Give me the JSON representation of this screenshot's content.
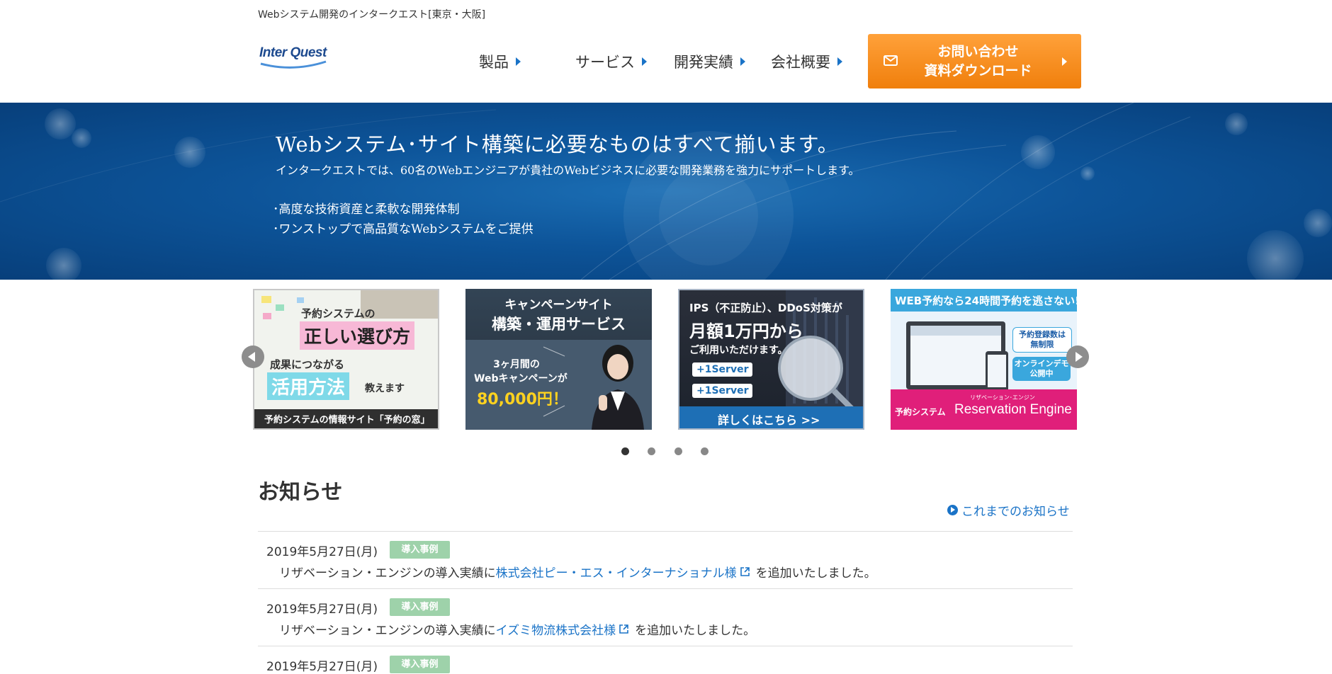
{
  "header": {
    "tagline": "Webシステム開発のインタークエスト[東京・大阪]",
    "logo_text": "Inter Quest",
    "nav": [
      {
        "label": "製品"
      },
      {
        "label": "サービス"
      },
      {
        "label": "開発実績"
      },
      {
        "label": "会社概要"
      }
    ],
    "contact_button": {
      "line1": "お問い合わせ",
      "line2": "資料ダウンロード"
    }
  },
  "hero": {
    "title": "Webシステム･サイト構築に必要なものはすべて揃います。",
    "description": "インタークエストでは、60名のWebエンジニアが貴社のWebビジネスに必要な開発業務を強力にサポートします。",
    "bullets": [
      "･高度な技術資産と柔軟な開発体制",
      "･ワンストップで高品質なWebシステムをご提供"
    ]
  },
  "carousel": {
    "slides": [
      {
        "line1": "予約システムの",
        "line2": "正しい選び方",
        "line3": "成果につながる",
        "line4": "活用方法",
        "line5": "教えます",
        "footer": "予約システムの情報サイト「予約の窓」"
      },
      {
        "line1": "キャンペーンサイト",
        "line2": "構築・運用サービス",
        "line3": "3ヶ月間の",
        "line4": "Webキャンペーンが",
        "line5": "80,000円！"
      },
      {
        "line1": "IPS（不正防止）、DDoS対策が",
        "line2": "月額1万円から",
        "line3": "ご利用いただけます。",
        "badge1": "+1Server",
        "badge2": "+1Server",
        "cta": "詳しくはこちら >>"
      },
      {
        "line1": "WEB予約なら24時間予約を逃さない!",
        "bubble1a": "予約登録数は",
        "bubble1b": "無制限",
        "bubble2a": "オンラインデモ",
        "bubble2b": "公開中",
        "footer_left": "予約システム",
        "footer_sub": "リザベーション･エンジン",
        "footer_brand": "Reservation Engine"
      }
    ],
    "active_index": 0,
    "dot_count": 4
  },
  "news": {
    "title": "お知らせ",
    "all_link": "これまでのお知らせ",
    "items": [
      {
        "date": "2019年5月27日(月)",
        "badge": "導入事例",
        "prefix": "リザベーション・エンジンの導入実績に",
        "link": "株式会社ピー・エス・インターナショナル様",
        "suffix": "を追加いたしました。"
      },
      {
        "date": "2019年5月27日(月)",
        "badge": "導入事例",
        "prefix": "リザベーション・エンジンの導入実績に",
        "link": "イズミ物流株式会社様",
        "suffix": "を追加いたしました。"
      },
      {
        "date": "2019年5月27日(月)",
        "badge": "導入事例"
      }
    ]
  },
  "colors": {
    "accent_blue": "#1a73c7",
    "cta_orange": "#f7901e",
    "badge_green": "#9ed2aa",
    "hero_blue": "#0d5499"
  }
}
